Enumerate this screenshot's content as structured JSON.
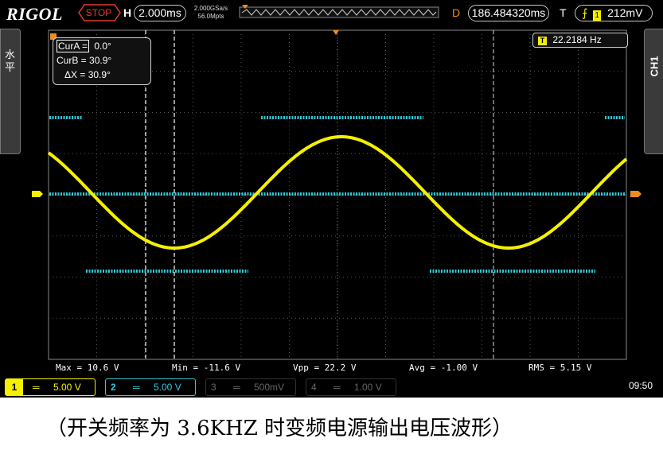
{
  "header": {
    "brand": "RIGOL",
    "run_state": "STOP",
    "h_label": "H",
    "timebase": "2.000ms",
    "sample_rate": "2.000GSa/s",
    "memory_depth": "56.0Mpts",
    "d_label": "D",
    "delay": "186.484320ms",
    "t_label": "T",
    "trigger_level": "212mV"
  },
  "side_tabs": {
    "left": "水平",
    "right": "CH1"
  },
  "cursor_readout": {
    "cur_a": "CurA =",
    "cur_a_value": "0.0°",
    "cur_b": "CurB = 30.9°",
    "delta_x": "ΔX = 30.9°"
  },
  "frequency_counter": "22.2184 Hz",
  "measurements": [
    "Max = 10.6 V",
    "Min = -11.6 V",
    "Vpp = 22.2 V",
    "Avg = -1.00 V",
    "RMS = 5.15 V"
  ],
  "channels": [
    {
      "num": "1",
      "scale": "5.00 V",
      "active": true
    },
    {
      "num": "2",
      "scale": "5.00 V",
      "active": true
    },
    {
      "num": "3",
      "scale": "500mV",
      "active": false
    },
    {
      "num": "4",
      "scale": "1.00 V",
      "active": false
    }
  ],
  "clock": "09:50",
  "caption": "（开关频率为 3.6KHZ 时变频电源输出电压波形）",
  "colors": {
    "ch1": "#f5f000",
    "ch2": "#2fc8d8",
    "accent_orange": "#f08c1e",
    "stop_red": "#e23b2e"
  }
}
